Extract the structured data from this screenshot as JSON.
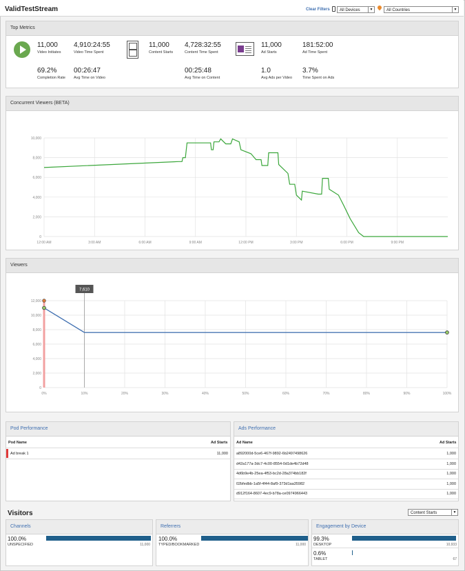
{
  "header": {
    "title": "ValidTestStream",
    "clear_filters": "Clear Filters",
    "device_select": "All Devices",
    "country_select": "All Countries"
  },
  "top_metrics": {
    "title": "Top Metrics",
    "video_initiates": {
      "value": "11,000",
      "label": "Video Initiates"
    },
    "video_time_spent": {
      "value": "4,910:24:55",
      "label": "Video Time Spent"
    },
    "completion_rate": {
      "value": "69.2%",
      "label": "Completion Rate"
    },
    "avg_time_on_video": {
      "value": "00:26:47",
      "label": "Avg Time on Video"
    },
    "content_starts": {
      "value": "11,000",
      "label": "Content Starts"
    },
    "content_time_spent": {
      "value": "4,728:32:55",
      "label": "Content Time Spent"
    },
    "avg_time_on_content": {
      "value": "00:25:48",
      "label": "Avg Time on Content"
    },
    "ad_starts": {
      "value": "11,000",
      "label": "Ad Starts"
    },
    "ad_time_spent": {
      "value": "181:52:00",
      "label": "Ad Time Spent"
    },
    "avg_ads_per_video": {
      "value": "1.0",
      "label": "Avg Ads per Video"
    },
    "time_spent_on_ads": {
      "value": "3.7%",
      "label": "Time Spent on Ads"
    }
  },
  "concurrent_viewers": {
    "title": "Concurrent Viewers (BETA)"
  },
  "viewers": {
    "title": "Viewers",
    "marker_label": "7,610"
  },
  "chart_data": [
    {
      "type": "line",
      "title": "Concurrent Viewers (BETA)",
      "color": "#3aa63a",
      "yticks": [
        "0",
        "2,000",
        "4,000",
        "6,000",
        "8,000",
        "10,000"
      ],
      "xticks": [
        "12:00 AM",
        "3:00 AM",
        "6:00 AM",
        "9:00 AM",
        "12:00 PM",
        "3:00 PM",
        "6:00 PM",
        "9:00 PM"
      ],
      "ylim": [
        0,
        10000
      ],
      "xlim": [
        0,
        24
      ],
      "x_unit": "hours",
      "points": [
        [
          0.0,
          7000
        ],
        [
          8.0,
          7600
        ],
        [
          8.2,
          7600
        ],
        [
          8.25,
          8000
        ],
        [
          8.4,
          8000
        ],
        [
          8.5,
          9500
        ],
        [
          9.9,
          9500
        ],
        [
          9.95,
          8800
        ],
        [
          10.05,
          8800
        ],
        [
          10.1,
          9600
        ],
        [
          10.4,
          9600
        ],
        [
          10.5,
          9900
        ],
        [
          10.8,
          9400
        ],
        [
          11.1,
          9400
        ],
        [
          11.2,
          9900
        ],
        [
          11.6,
          9600
        ],
        [
          11.7,
          8800
        ],
        [
          12.3,
          8400
        ],
        [
          12.6,
          7800
        ],
        [
          12.9,
          7800
        ],
        [
          12.95,
          7200
        ],
        [
          13.3,
          7200
        ],
        [
          13.35,
          8500
        ],
        [
          13.9,
          8500
        ],
        [
          13.95,
          7300
        ],
        [
          14.5,
          6400
        ],
        [
          14.6,
          5300
        ],
        [
          14.9,
          5300
        ],
        [
          15.0,
          4200
        ],
        [
          15.3,
          3700
        ],
        [
          15.35,
          4600
        ],
        [
          16.3,
          4300
        ],
        [
          16.5,
          4300
        ],
        [
          16.55,
          5900
        ],
        [
          16.9,
          5900
        ],
        [
          16.95,
          4800
        ],
        [
          17.5,
          4200
        ],
        [
          17.8,
          3200
        ],
        [
          18.2,
          1800
        ],
        [
          18.7,
          400
        ],
        [
          19.0,
          0
        ],
        [
          24.0,
          0
        ]
      ]
    },
    {
      "type": "line",
      "title": "Viewers",
      "color": "#3f6fb0",
      "yticks": [
        "0",
        "2,000",
        "4,000",
        "6,000",
        "8,000",
        "10,000",
        "12,000"
      ],
      "xticks": [
        "0%",
        "10%",
        "20%",
        "30%",
        "40%",
        "50%",
        "60%",
        "70%",
        "80%",
        "90%",
        "100%"
      ],
      "ylim": [
        0,
        12000
      ],
      "xlim": [
        0,
        100
      ],
      "points": [
        [
          0,
          11000
        ],
        [
          10,
          7610
        ],
        [
          100,
          7610
        ]
      ],
      "top_marker": [
        0,
        12000
      ]
    }
  ],
  "pod_performance": {
    "title": "Pod Performance",
    "col_name": "Pod Name",
    "col_starts": "Ad Starts",
    "rows": [
      {
        "name": "Ad break 1",
        "starts": "11,000"
      }
    ]
  },
  "ads_performance": {
    "title": "Ads Performance",
    "col_name": "Ad Name",
    "col_starts": "Ad Starts",
    "rows": [
      {
        "name": "a892000d-5ce6-467f-9892-6b2497498626",
        "starts": "1,000"
      },
      {
        "name": "d42a177a-3dc7-4c00-8554-0d1de4b72d48",
        "starts": "1,000"
      },
      {
        "name": "4d6b9e4b-25ea-4f53-bc2d-28a374bb182f",
        "starts": "1,000"
      },
      {
        "name": "02bfedbb-1a5f-4f44-8af9-373d1aa35982",
        "starts": "1,000"
      },
      {
        "name": "d912f164-8607-4ec9-b78a-ce0974966443",
        "starts": "1,000"
      }
    ]
  },
  "visitors": {
    "title": "Visitors",
    "select": "Content Starts",
    "channels": {
      "title": "Channels",
      "pct": "100.0%",
      "label": "UNSPECIFIED",
      "count": "11,000",
      "fill": 1.0
    },
    "referrers": {
      "title": "Referrers",
      "pct": "100.0%",
      "label": "TYPED/BOOKMARKED",
      "count": "11,000",
      "fill": 1.0
    },
    "engagement": {
      "title": "Engagement by Device",
      "rows": [
        {
          "pct": "99.3%",
          "label": "DESKTOP",
          "count": "10,933",
          "fill": 0.993
        },
        {
          "pct": "0.6%",
          "label": "TABLET",
          "count": "67",
          "fill": 0.006
        }
      ]
    },
    "bar_color": "#1f5f8b"
  }
}
